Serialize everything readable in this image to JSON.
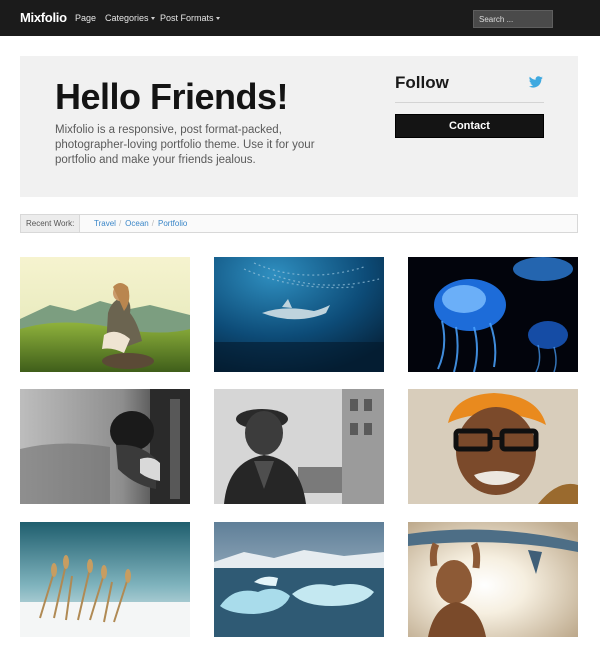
{
  "nav": {
    "brand": "Mixfolio",
    "items": [
      {
        "label": "Page"
      },
      {
        "label": "Categories"
      },
      {
        "label": "Post Formats"
      }
    ],
    "search_placeholder": "Search ..."
  },
  "hero": {
    "title": "Hello Friends!",
    "text": "Mixfolio is a responsive, post format-packed, photographer-loving portfolio theme. Use it for your portfolio and make your friends jealous.",
    "follow_label": "Follow",
    "twitter_icon": "twitter-bird-icon",
    "contact_label": "Contact"
  },
  "breadcrumb": {
    "label": "Recent Work:",
    "links": [
      "Travel",
      "Ocean",
      "Portfolio"
    ]
  },
  "colors": {
    "topbar": "#1b1b1b",
    "hero_bg": "#f1f1f1",
    "link": "#3a86c8",
    "twitter": "#3fa9e0",
    "button": "#141414"
  },
  "gallery": [
    {
      "subject": "woman sitting on grassy hilltop"
    },
    {
      "subject": "shark under a school of fish"
    },
    {
      "subject": "glowing blue jellyfish"
    },
    {
      "subject": "person leaning out of train window"
    },
    {
      "subject": "man in flat cap and coat"
    },
    {
      "subject": "old man with glasses and orange turban"
    },
    {
      "subject": "dry grass stalks in snow"
    },
    {
      "subject": "icebergs on water"
    },
    {
      "subject": "surfer holding board overhead"
    }
  ]
}
